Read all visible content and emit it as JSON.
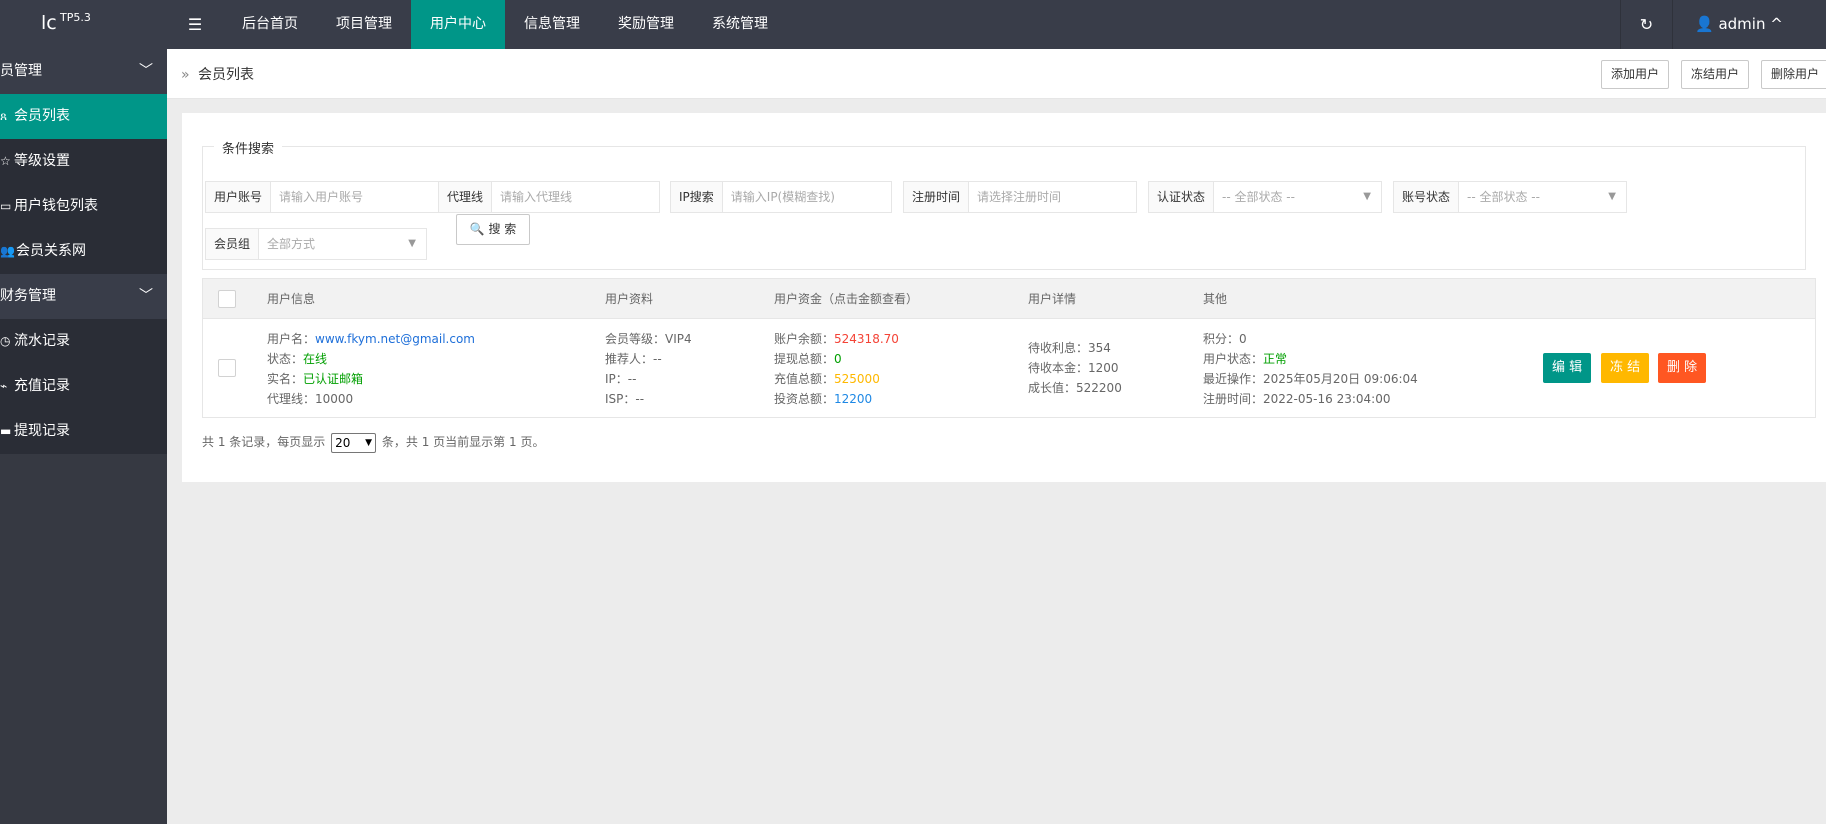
{
  "app": {
    "logo_text": "lc",
    "version": "TP5.3",
    "menu_icon": "menu-icon"
  },
  "topnav": {
    "items": [
      {
        "label": "后台首页",
        "active": false
      },
      {
        "label": "项目管理",
        "active": false
      },
      {
        "label": "用户中心",
        "active": true
      },
      {
        "label": "信息管理",
        "active": false
      },
      {
        "label": "奖励管理",
        "active": false
      },
      {
        "label": "系统管理",
        "active": false
      }
    ],
    "refresh_icon": "refresh-icon",
    "user": {
      "icon": "user-icon",
      "name": "admin",
      "chevron": "^"
    }
  },
  "sidebar": {
    "groups": [
      {
        "label": "员管理",
        "chevron": "﹀",
        "items": [
          {
            "label": "会员列表",
            "icon": "user-icon",
            "active": true
          },
          {
            "label": "等级设置",
            "icon": "star-icon",
            "active": false
          },
          {
            "label": "用户钱包列表",
            "icon": "wallet-icon",
            "active": false
          },
          {
            "label": "会员关系网",
            "icon": "users-icon",
            "active": false
          }
        ]
      },
      {
        "label": "财务管理",
        "chevron": "﹀",
        "items": [
          {
            "label": "流水记录",
            "icon": "clock-icon",
            "active": false
          },
          {
            "label": "充值记录",
            "icon": "chart-icon",
            "active": false
          },
          {
            "label": "提现记录",
            "icon": "card-icon",
            "active": false
          }
        ]
      }
    ]
  },
  "breadcrumb": {
    "arrow": "»",
    "label": "会员列表"
  },
  "header_buttons": {
    "add": "添加用户",
    "freeze": "冻结用户",
    "delete": "删除用户"
  },
  "search": {
    "legend": "条件搜索",
    "fields": {
      "account": {
        "label": "用户账号",
        "placeholder": "请输入用户账号"
      },
      "agent": {
        "label": "代理线",
        "placeholder": "请输入代理线"
      },
      "ip": {
        "label": "IP搜索",
        "placeholder": "请输入IP(模糊查找)"
      },
      "regtime": {
        "label": "注册时间",
        "placeholder": "请选择注册时间"
      },
      "auth": {
        "label": "认证状态",
        "value": "-- 全部状态 --"
      },
      "status": {
        "label": "账号状态",
        "value": "-- 全部状态 --"
      },
      "group": {
        "label": "会员组",
        "value": "全部方式"
      }
    },
    "button": "搜 索",
    "button_icon": "search-icon"
  },
  "table": {
    "headers": {
      "info": "用户信息",
      "profile": "用户资料",
      "funds": "用户资金（点击金额查看）",
      "details": "用户详情",
      "other": "其他"
    },
    "row": {
      "info": {
        "username_label": "用户名：",
        "username": "www.fkym.net@gmail.com",
        "status_label": "状态：",
        "status": "在线",
        "realname_label": "实名：",
        "realname": "已认证邮箱",
        "agent_label": "代理线：",
        "agent": "10000"
      },
      "profile": {
        "level_label": "会员等级：",
        "level": "VIP4",
        "referrer_label": "推荐人：",
        "referrer": "--",
        "ip_label": "IP：",
        "ip": "--",
        "isp_label": "ISP：",
        "isp": "--"
      },
      "funds": {
        "balance_label": "账户余额：",
        "balance": "524318.70",
        "withdraw_label": "提现总额：",
        "withdraw": "0",
        "recharge_label": "充值总额：",
        "recharge": "525000",
        "invest_label": "投资总额：",
        "invest": "12200"
      },
      "details": {
        "interest_label": "待收利息：",
        "interest": "354",
        "principal_label": "待收本金：",
        "principal": "1200",
        "growth_label": "成长值：",
        "growth": "522200"
      },
      "other": {
        "points_label": "积分：",
        "points": "0",
        "ustatus_label": "用户状态：",
        "ustatus": "正常",
        "lastop_label": "最近操作：",
        "lastop": "2025年05月20日 09:06:04",
        "regtime_label": "注册时间：",
        "regtime": "2022-05-16 23:04:00"
      },
      "actions": {
        "edit": "编 辑",
        "freeze": "冻 结",
        "delete": "删 除"
      }
    }
  },
  "pagination": {
    "text_before": "共 1 条记录，每页显示",
    "page_size": "20",
    "text_after": "条，共 1 页当前显示第 1 页。"
  },
  "colors": {
    "accent": "#009688",
    "topbar": "#393d49",
    "edit": "#009688",
    "freeze": "#ffb800",
    "delete": "#ff5722"
  }
}
